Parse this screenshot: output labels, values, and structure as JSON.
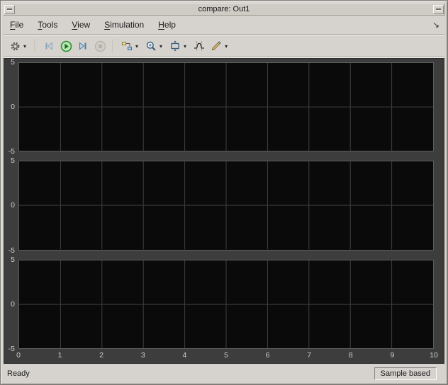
{
  "window": {
    "title": "compare: Out1",
    "bg": "#d6d3ce"
  },
  "titlebar": {
    "left_button": "window-menu",
    "right_button": "window-restore"
  },
  "menubar": {
    "items": [
      {
        "label": "File",
        "mnemonic_index": 0
      },
      {
        "label": "Tools",
        "mnemonic_index": 0
      },
      {
        "label": "View",
        "mnemonic_index": 0
      },
      {
        "label": "Simulation",
        "mnemonic_index": 0
      },
      {
        "label": "Help",
        "mnemonic_index": 0
      }
    ],
    "dock_arrow": "↘"
  },
  "toolbar": {
    "buttons": [
      {
        "id": "configuration",
        "icon": "gear-icon",
        "dropdown": true
      },
      {
        "separator": true
      },
      {
        "id": "step-back",
        "icon": "step-back-icon",
        "disabled": true
      },
      {
        "id": "run",
        "icon": "run-icon"
      },
      {
        "id": "step-forward",
        "icon": "step-forward-icon"
      },
      {
        "id": "stop",
        "icon": "stop-icon",
        "disabled": true
      },
      {
        "separator": true
      },
      {
        "id": "signal-selector",
        "icon": "signal-selector-icon",
        "dropdown": true
      },
      {
        "id": "zoom",
        "icon": "zoom-icon",
        "dropdown": true
      },
      {
        "id": "scale-axes",
        "icon": "autoscale-icon",
        "dropdown": true
      },
      {
        "id": "cursor-measurements",
        "icon": "cursor-measurements-icon"
      },
      {
        "id": "style",
        "icon": "brush-icon",
        "dropdown": true
      }
    ],
    "colors": {
      "run_green": "#2e8f2e",
      "step_blue": "#4f7da6",
      "disabled_gray": "#9b988f"
    }
  },
  "scope": {
    "canvas_bg": "#3d3d3d",
    "plot_bg": "#0a0a0a",
    "grid_color": "#3f3f3f",
    "tick_color": "#cdcdcd",
    "axes_count": 3,
    "y_ticks": [
      "5",
      "0",
      "-5"
    ],
    "x_ticks": [
      "0",
      "1",
      "2",
      "3",
      "4",
      "5",
      "6",
      "7",
      "8",
      "9",
      "10"
    ]
  },
  "chart_data": [
    {
      "type": "line",
      "title": "",
      "xlabel": "",
      "ylabel": "",
      "xlim": [
        0,
        10
      ],
      "ylim": [
        -5,
        5
      ],
      "series": [],
      "grid": true,
      "legend": false
    },
    {
      "type": "line",
      "title": "",
      "xlabel": "",
      "ylabel": "",
      "xlim": [
        0,
        10
      ],
      "ylim": [
        -5,
        5
      ],
      "series": [],
      "grid": true,
      "legend": false
    },
    {
      "type": "line",
      "title": "",
      "xlabel": "",
      "ylabel": "",
      "xlim": [
        0,
        10
      ],
      "ylim": [
        -5,
        5
      ],
      "series": [],
      "grid": true,
      "legend": false
    }
  ],
  "statusbar": {
    "left": "Ready",
    "right": "Sample based"
  }
}
